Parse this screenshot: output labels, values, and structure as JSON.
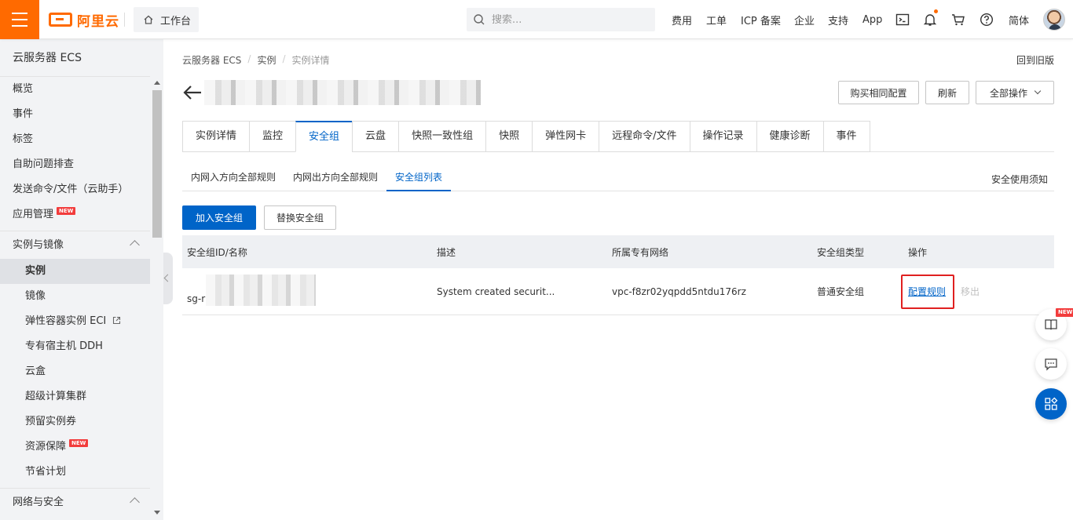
{
  "topbar": {
    "logo_text": "阿里云",
    "workbench": "工作台",
    "search_placeholder": "搜索...",
    "nav": [
      "费用",
      "工单",
      "ICP 备案",
      "企业",
      "支持",
      "App"
    ],
    "lang": "简体",
    "accent": "#ff6a00"
  },
  "sidebar": {
    "title": "云服务器 ECS",
    "top_items": [
      "概览",
      "事件",
      "标签",
      "自助问题排查",
      "发送命令/文件（云助手）",
      "应用管理"
    ],
    "new_badge": "NEW",
    "group1": "实例与镜像",
    "group1_items": [
      "实例",
      "镜像",
      "弹性容器实例 ECI",
      "专有宿主机 DDH",
      "云盒",
      "超级计算集群",
      "预留实例券",
      "资源保障",
      "节省计划"
    ],
    "group2": "网络与安全"
  },
  "breadcrumb": [
    "云服务器 ECS",
    "实例",
    "实例详情"
  ],
  "back_old": "回到旧版",
  "header_buttons": {
    "buy_same": "购买相同配置",
    "refresh": "刷新",
    "all_ops": "全部操作"
  },
  "tabs": [
    "实例详情",
    "监控",
    "安全组",
    "云盘",
    "快照一致性组",
    "快照",
    "弹性网卡",
    "远程命令/文件",
    "操作记录",
    "健康诊断",
    "事件"
  ],
  "active_tab": "安全组",
  "subtabs": [
    "内网入方向全部规则",
    "内网出方向全部规则",
    "安全组列表"
  ],
  "notice": "安全使用须知",
  "actions": {
    "add": "加入安全组",
    "replace": "替换安全组"
  },
  "table": {
    "headers": [
      "安全组ID/名称",
      "描述",
      "所属专有网络",
      "安全组类型",
      "操作"
    ],
    "rows": [
      {
        "id": "sg-r",
        "desc": "System created securit...",
        "vpc": "vpc-f8zr02yqpdd5ntdu176rz",
        "type": "普通安全组",
        "op_config": "配置规则",
        "op_remove": "移出"
      }
    ]
  },
  "float": {
    "new_badge": "NEW"
  }
}
